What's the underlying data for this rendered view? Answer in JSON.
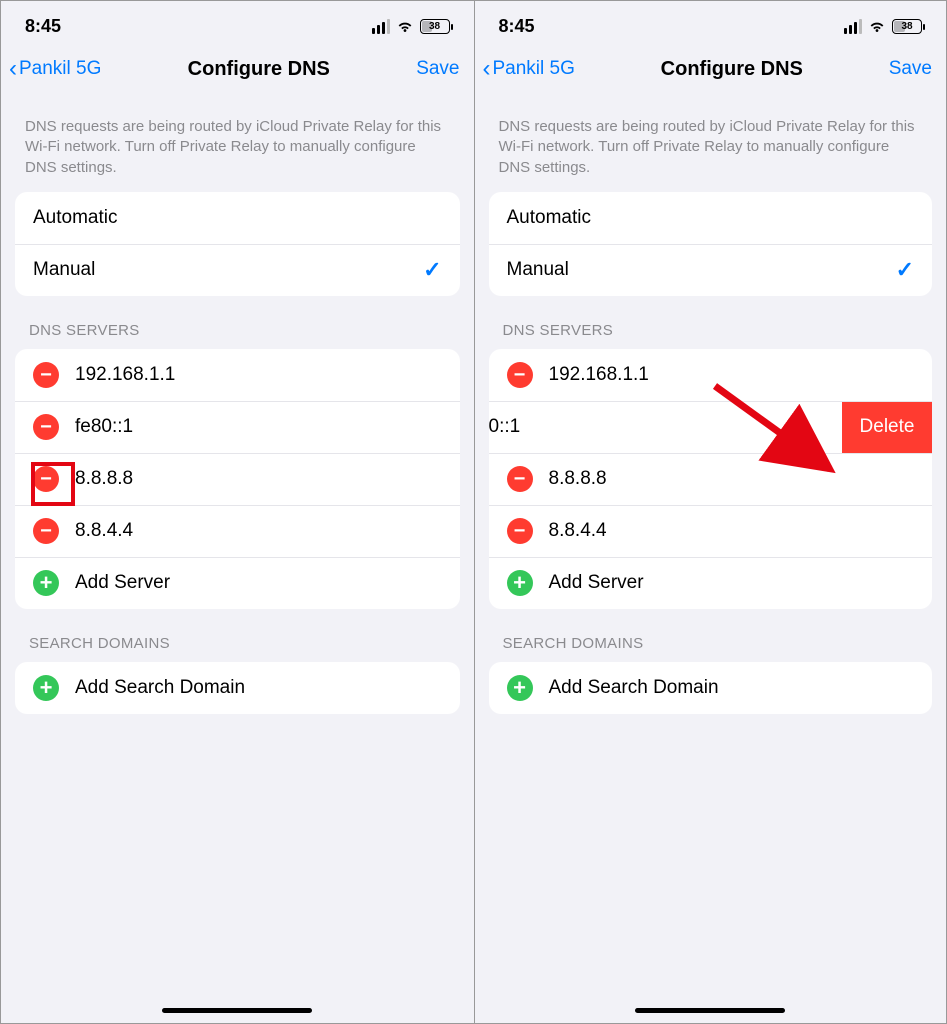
{
  "status": {
    "time": "8:45",
    "battery": "38"
  },
  "nav": {
    "back": "Pankil 5G",
    "title": "Configure DNS",
    "save": "Save"
  },
  "info": "DNS requests are being routed by iCloud Private Relay for this Wi-Fi network. Turn off Private Relay to manually configure DNS settings.",
  "mode": {
    "automatic": "Automatic",
    "manual": "Manual"
  },
  "headers": {
    "dns": "DNS SERVERS",
    "search": "SEARCH DOMAINS"
  },
  "dns_left": {
    "rows": [
      "192.168.1.1",
      "fe80::1",
      "8.8.8.8",
      "8.8.4.4"
    ],
    "add": "Add Server"
  },
  "dns_right": {
    "rows": [
      "192.168.1.1",
      "0::1",
      "8.8.8.8",
      "8.8.4.4"
    ],
    "add": "Add Server"
  },
  "delete_label": "Delete",
  "search": {
    "add": "Add Search Domain"
  }
}
